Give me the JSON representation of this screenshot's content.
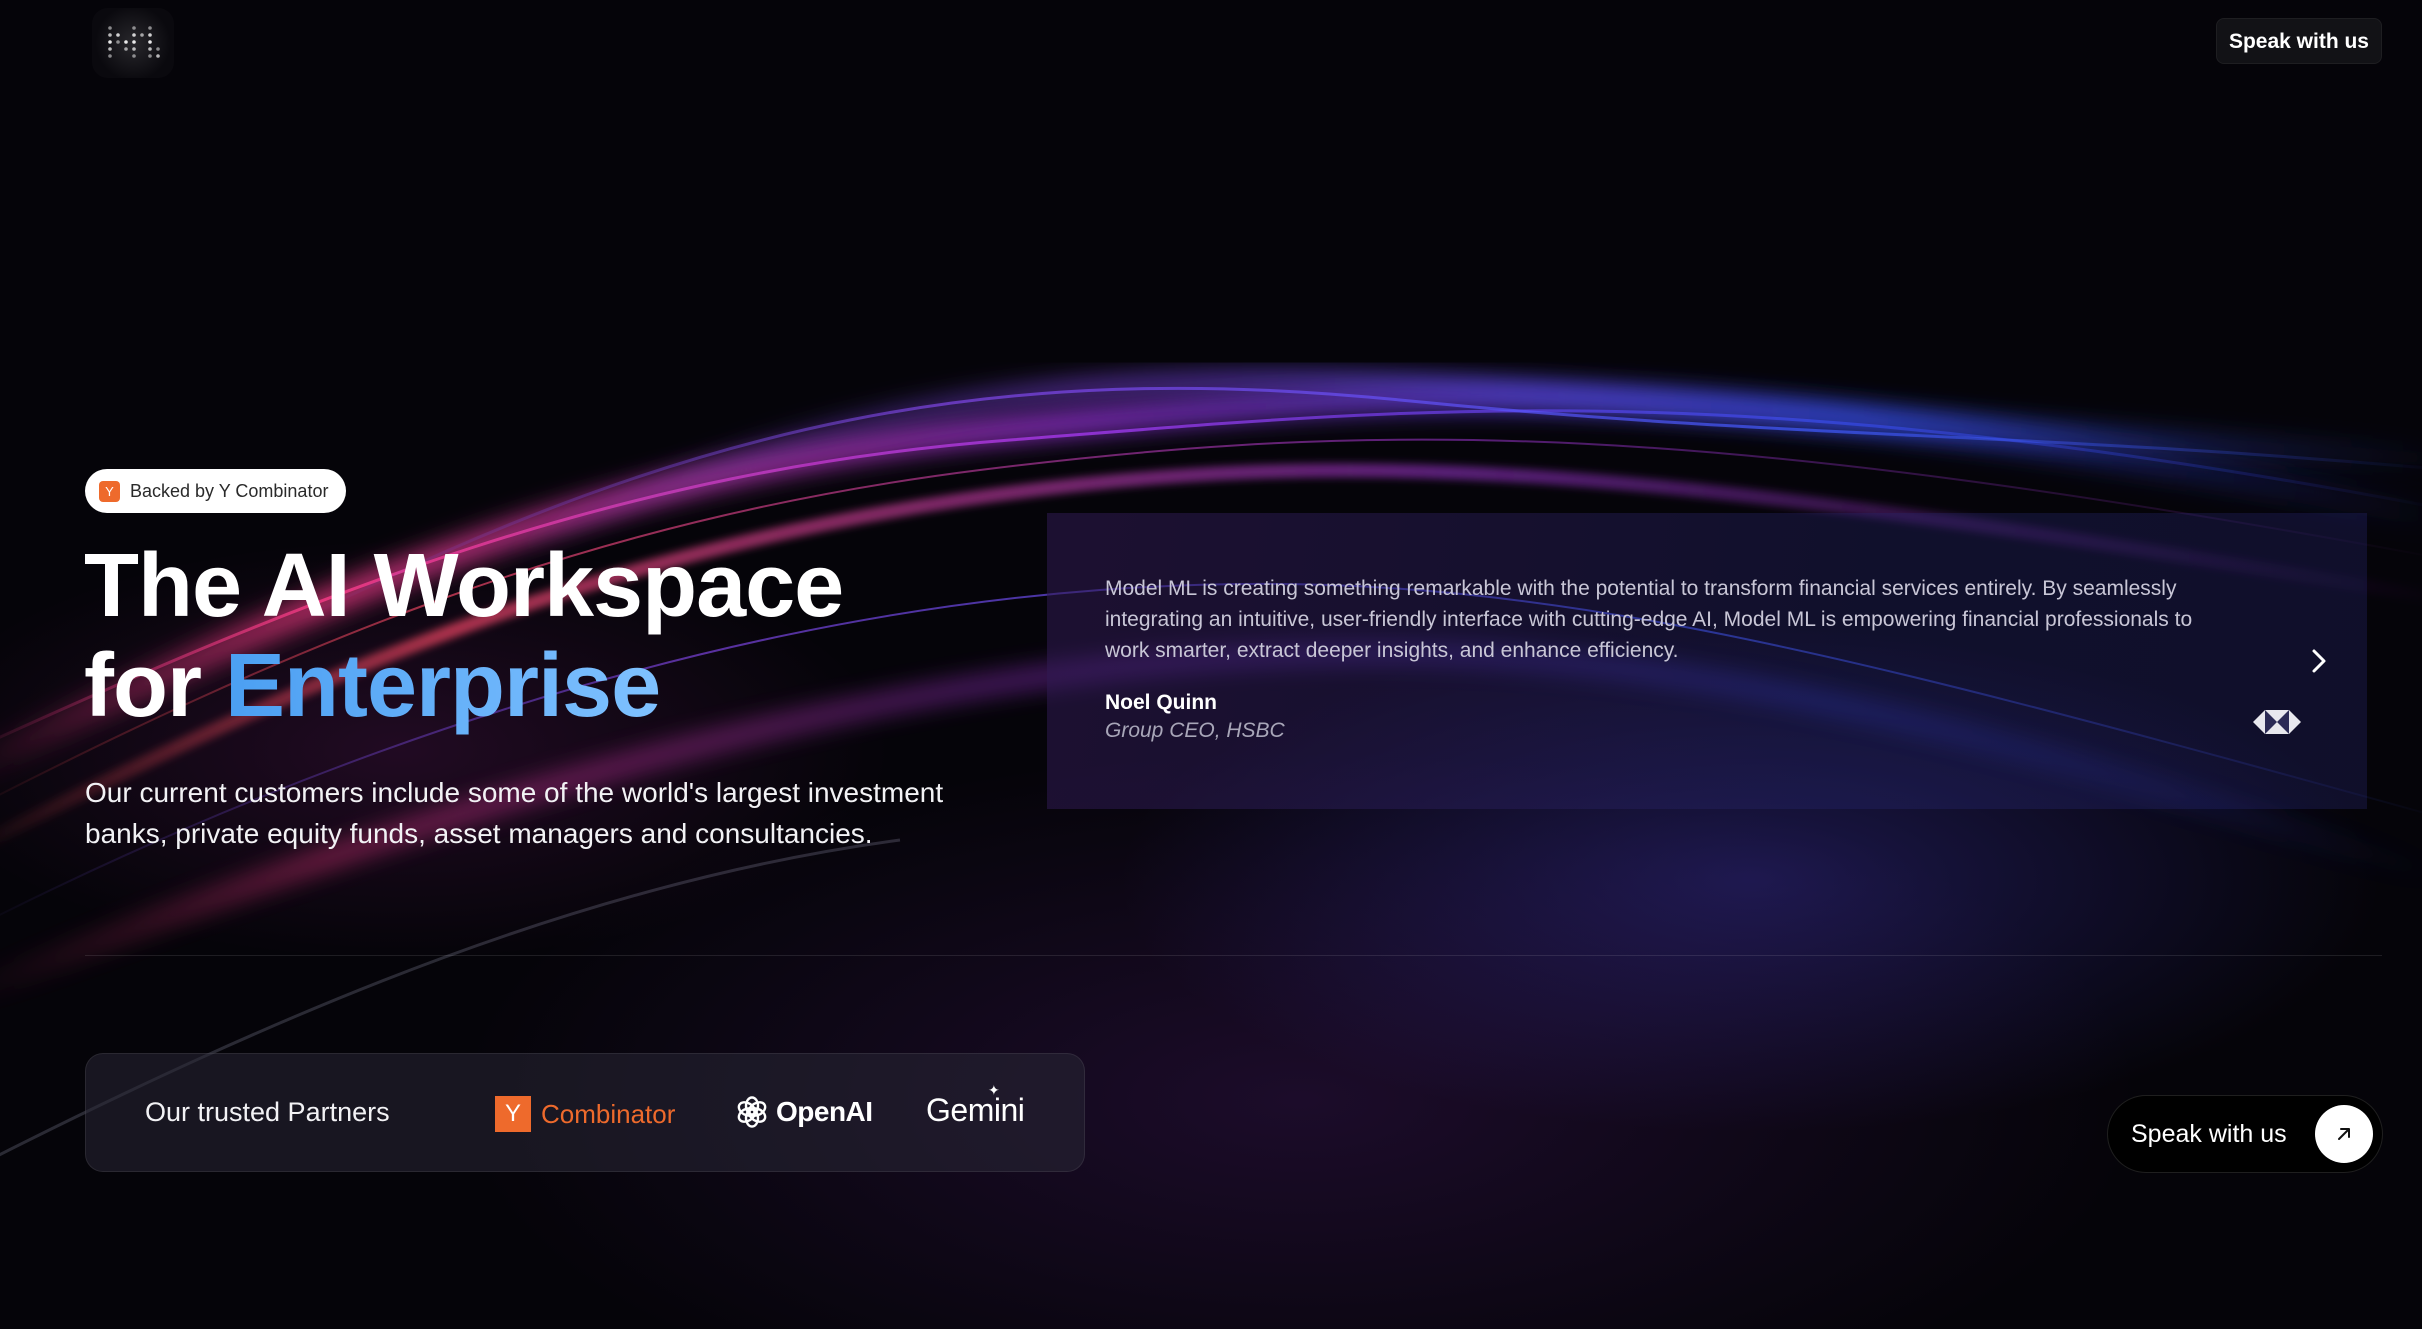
{
  "header": {
    "logo_icon": "modelml-dot-grid-logo",
    "cta_label": "Speak with us"
  },
  "hero": {
    "badge": {
      "icon_letter": "Y",
      "label": "Backed by Y Combinator"
    },
    "title_line1": "The AI Workspace",
    "title_line2_prefix": "for",
    "title_line2_accent": "Enterprise",
    "subtitle": "Our current customers include some of the world's largest investment banks, private equity funds, asset managers and consultancies."
  },
  "testimonial": {
    "quote": "Model ML is creating something remarkable with the potential to transform financial services entirely. By seamlessly integrating an intuitive, user-friendly interface with cutting-edge AI, Model ML is empowering financial professionals to work smarter, extract deeper insights, and enhance efficiency.",
    "author_name": "Noel Quinn",
    "author_role": "Group CEO, HSBC",
    "company_icon": "hsbc-hexagon-logo",
    "next_icon": "chevron-right-icon"
  },
  "partners": {
    "label": "Our trusted Partners",
    "items": [
      {
        "name": "yc",
        "mark": "Y",
        "text": "Combinator"
      },
      {
        "name": "openai",
        "text": "OpenAI"
      },
      {
        "name": "gemini",
        "text": "Gemini"
      }
    ]
  },
  "bottom_cta": {
    "label": "Speak with us",
    "icon": "arrow-up-right-icon"
  },
  "colors": {
    "background": "#050409",
    "accent_blue": "#5aaaf5",
    "yc_orange": "#ee6a2c"
  }
}
